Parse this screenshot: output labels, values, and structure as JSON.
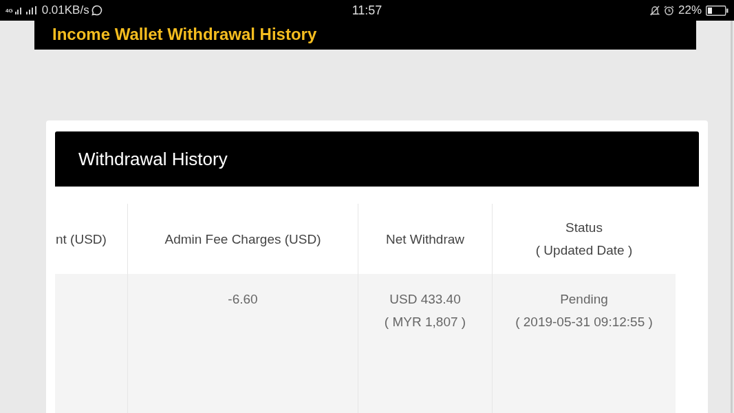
{
  "status_bar": {
    "network": "4G",
    "speed": "0.01KB/s",
    "time": "11:57",
    "battery": "22%"
  },
  "page_title": "Income Wallet Withdrawal History",
  "card": {
    "title": "Withdrawal History",
    "table": {
      "columns": [
        {
          "title": "nt (USD)"
        },
        {
          "title": "Admin Fee Charges (USD)"
        },
        {
          "title": "Net Withdraw"
        },
        {
          "title": "Status",
          "subtitle": "( Updated Date )"
        }
      ],
      "rows": [
        [
          {},
          {
            "value": "-6.60"
          },
          {
            "value": "USD 433.40",
            "note": "( MYR 1,807 )"
          },
          {
            "value": "Pending",
            "note": "( 2019-05-31 09:12:55 )"
          }
        ]
      ]
    }
  }
}
